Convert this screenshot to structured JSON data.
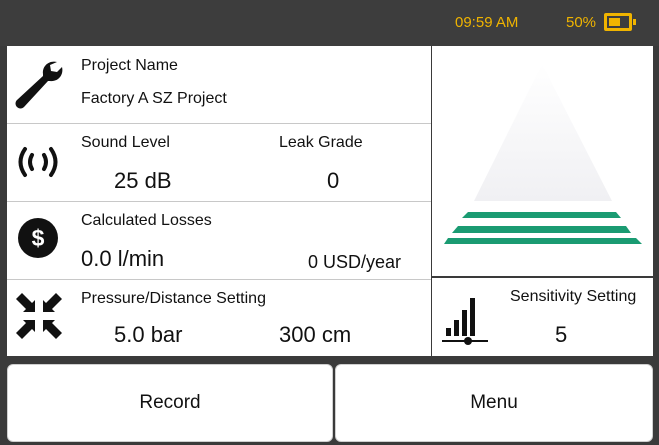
{
  "status_bar": {
    "time": "09:59 AM",
    "battery_percent": "50%",
    "battery_level": 0.5,
    "accent_color": "#f0b400"
  },
  "project": {
    "label": "Project Name",
    "value": "Factory A SZ Project",
    "icon": "wrench-icon"
  },
  "sound": {
    "sound_label": "Sound Level",
    "sound_value": "25 dB",
    "grade_label": "Leak Grade",
    "grade_value": "0",
    "icon": "sound-waves-icon"
  },
  "losses": {
    "label": "Calculated Losses",
    "flow_value": "0.0 l/min",
    "cost_value": "0 USD/year",
    "icon": "dollar-icon"
  },
  "pressure": {
    "label": "Pressure/Distance Setting",
    "pressure_value": "5.0 bar",
    "distance_value": "300 cm",
    "icon": "compress-arrows-icon"
  },
  "sensitivity": {
    "label": "Sensitivity Setting",
    "value": "5",
    "icon": "signal-bars-icon"
  },
  "grade_indicator": {
    "level": 0,
    "color": "#1a9b72"
  },
  "buttons": {
    "record": "Record",
    "menu": "Menu"
  }
}
